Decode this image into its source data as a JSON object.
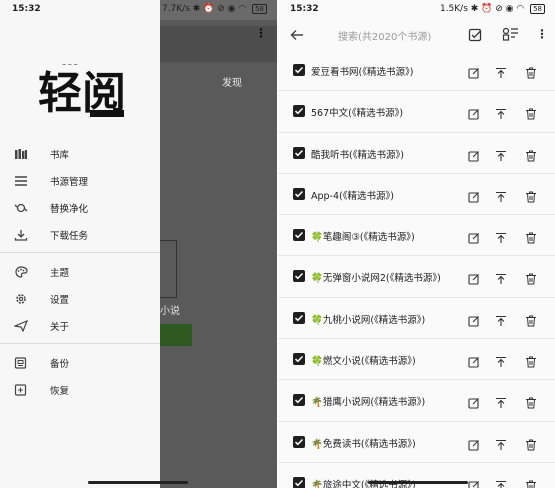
{
  "left_phone": {
    "status": {
      "time": "15:32",
      "speed": "7.7K/s",
      "battery": "58"
    },
    "background": {
      "tab_label": "发现",
      "book_label": "小说"
    },
    "drawer": {
      "logo_text": "轻阅",
      "menu_groups": [
        [
          {
            "icon": "bookshelf-icon",
            "label": "书库"
          },
          {
            "icon": "list-icon",
            "label": "书源管理"
          },
          {
            "icon": "search-replace-icon",
            "label": "替换净化"
          },
          {
            "icon": "download-icon",
            "label": "下载任务"
          }
        ],
        [
          {
            "icon": "palette-icon",
            "label": "主题"
          },
          {
            "icon": "gear-icon",
            "label": "设置"
          },
          {
            "icon": "send-icon",
            "label": "关于"
          }
        ],
        [
          {
            "icon": "backup-icon",
            "label": "备份"
          },
          {
            "icon": "restore-icon",
            "label": "恢复"
          }
        ]
      ]
    }
  },
  "right_phone": {
    "status": {
      "time": "15:32",
      "speed": "1.5K/s",
      "battery": "58"
    },
    "toolbar": {
      "search_placeholder": "搜索(共2020个书源)"
    },
    "sources": [
      {
        "name": "爱豆看书网(《精选书源》)"
      },
      {
        "name": "567中文(《精选书源》)"
      },
      {
        "name": "酷我听书(《精选书源》)"
      },
      {
        "name": "App-4(《精选书源》)"
      },
      {
        "name": "🍀笔趣阁③(《精选书源》)"
      },
      {
        "name": "🍀无弹窗小说网2(《精选书源》)"
      },
      {
        "name": "🍀九桃小说网(《精选书源》)"
      },
      {
        "name": "🍀燃文小说(《精选书源》)"
      },
      {
        "name": "🌴猎鹰小说网(《精选书源》)"
      },
      {
        "name": "🌴免费读书(《精选书源》)"
      },
      {
        "name": "🌴旅途中文(《精选书源》)"
      }
    ]
  }
}
